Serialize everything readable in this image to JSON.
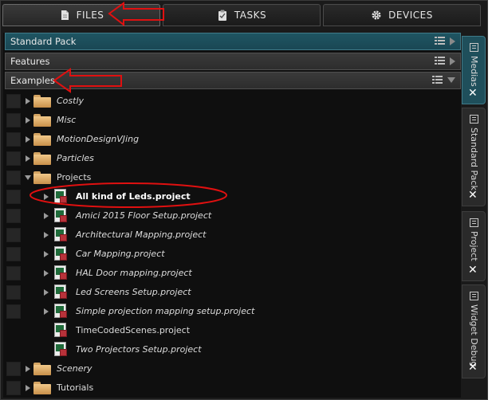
{
  "tabs": [
    {
      "label": "FILES",
      "icon": "document-icon",
      "active": true
    },
    {
      "label": "TASKS",
      "icon": "clipboard-icon",
      "active": false
    },
    {
      "label": "DEVICES",
      "icon": "gear-icon",
      "active": false
    }
  ],
  "sections": {
    "standard": "Standard Pack",
    "features": "Features",
    "examples": "Examples"
  },
  "tree": [
    {
      "label": "Costly",
      "type": "folder",
      "expanded": false
    },
    {
      "label": "Misc",
      "type": "folder",
      "expanded": false
    },
    {
      "label": "MotionDesignVJing",
      "type": "folder",
      "expanded": false
    },
    {
      "label": "Particles",
      "type": "folder",
      "expanded": false
    },
    {
      "label": "Projects",
      "type": "folder",
      "expanded": true
    },
    {
      "label": "All kind of Leds.project",
      "type": "project",
      "expandable": true,
      "highlighted": true
    },
    {
      "label": "Amici 2015 Floor Setup.project",
      "type": "project",
      "expandable": true
    },
    {
      "label": "Architectural Mapping.project",
      "type": "project",
      "expandable": true
    },
    {
      "label": "Car Mapping.project",
      "type": "project",
      "expandable": true
    },
    {
      "label": "HAL Door mapping.project",
      "type": "project",
      "expandable": true
    },
    {
      "label": "Led Screens Setup.project",
      "type": "project",
      "expandable": true
    },
    {
      "label": "Simple projection mapping setup.project",
      "type": "project",
      "expandable": true
    },
    {
      "label": "TimeCodedScenes.project",
      "type": "project",
      "expandable": false
    },
    {
      "label": "Two Projectors Setup.project",
      "type": "project",
      "expandable": false
    },
    {
      "label": "Scenery",
      "type": "folder",
      "expanded": false
    },
    {
      "label": "Tutorials",
      "type": "folder",
      "expanded": false
    }
  ],
  "side_tabs": [
    {
      "label": "Medias",
      "active": true
    },
    {
      "label": "Standard Pack",
      "active": false
    },
    {
      "label": "Project",
      "active": false
    },
    {
      "label": "Widget Debug",
      "active": false
    }
  ],
  "colors": {
    "accent": "#1f5562",
    "annotation": "#e01010",
    "folder": "#e8b574"
  }
}
